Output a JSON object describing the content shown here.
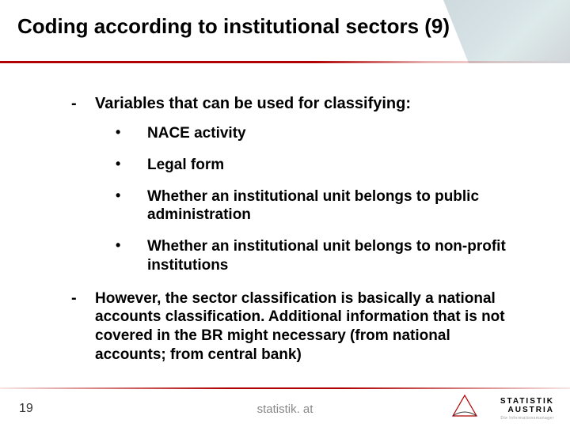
{
  "title": "Coding according to institutional sectors (9)",
  "section1": {
    "lead": "Variables that can be used for classifying:",
    "bullets": [
      "NACE activity",
      "Legal form",
      "Whether an institutional unit belongs to public administration",
      "Whether an institutional unit belongs to non-profit institutions"
    ]
  },
  "section2": "However, the sector classification is basically a national accounts classification. Additional information that is not covered in the BR might necessary (from national accounts; from central bank)",
  "footer": {
    "page": "19",
    "site": "statistik. at",
    "logo_text": "STATISTIK AUSTRIA",
    "logo_sub": "Die Informationsmanager"
  }
}
